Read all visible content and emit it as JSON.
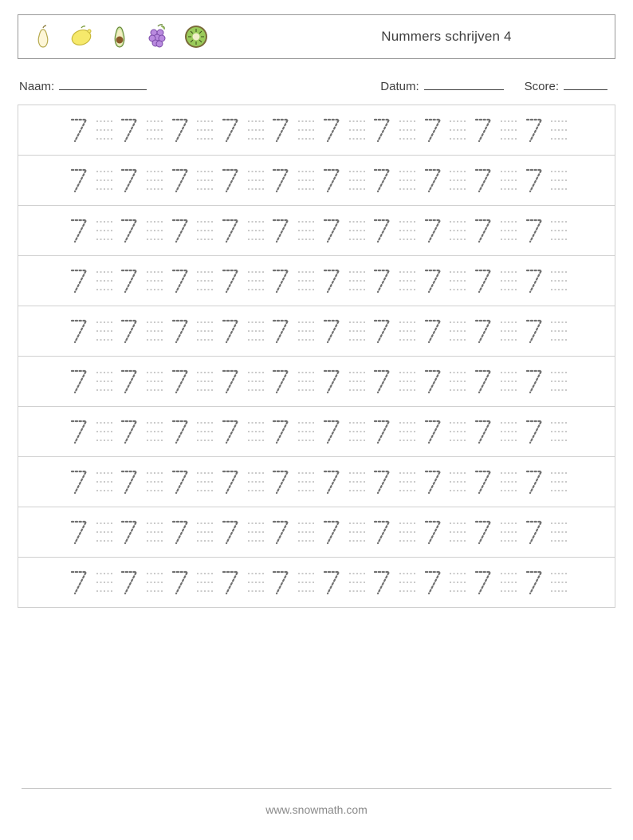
{
  "header": {
    "title": "Nummers schrijven 4",
    "fruits": [
      "pear",
      "lemon",
      "avocado",
      "grapes",
      "kiwi"
    ]
  },
  "meta": {
    "name_label": "Naam:",
    "date_label": "Datum:",
    "score_label": "Score:"
  },
  "worksheet": {
    "digit": "7",
    "rows": 10,
    "traces_per_row": 10,
    "guides_per_row": 10
  },
  "footer": {
    "url": "www.snowmath.com"
  }
}
